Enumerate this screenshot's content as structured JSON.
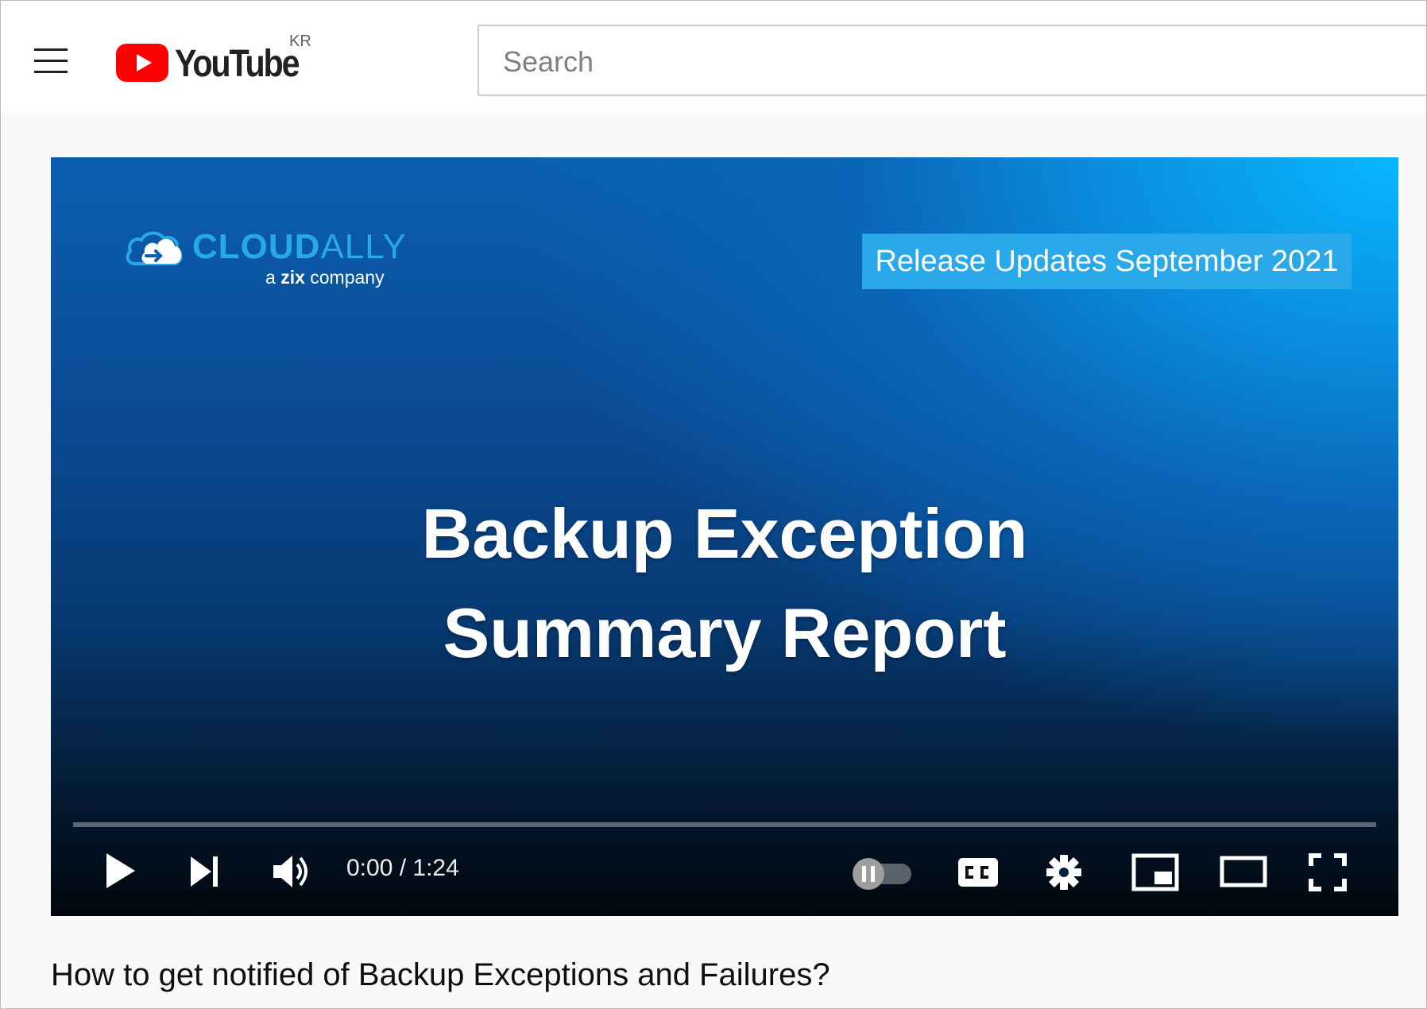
{
  "header": {
    "menu_icon": "hamburger-menu-icon",
    "logo_text": "YouTube",
    "country_code": "KR",
    "search_placeholder": "Search"
  },
  "video": {
    "brand_name_bold": "CLOUD",
    "brand_name_light": "ALLY",
    "brand_tagline_a": "a",
    "brand_tagline_zix": "zix",
    "brand_tagline_rest": "company",
    "release_badge": "Release Updates September 2021",
    "title_line1": "Backup Exception",
    "title_line2": "Summary Report",
    "progress_fraction": 0,
    "controls": {
      "current_time": "0:00",
      "duration": "1:24",
      "time_separator": " / ",
      "time_display": "0:00 / 1:24",
      "icons": [
        "play-icon",
        "next-icon",
        "volume-icon",
        "autoplay-toggle",
        "cc-icon",
        "settings-gear-icon",
        "miniplayer-icon",
        "theater-mode-icon",
        "fullscreen-icon"
      ]
    }
  },
  "page": {
    "video_title": "How to get notified of Backup Exceptions and Failures?"
  },
  "colors": {
    "youtube_red": "#ff0000",
    "brand_blue": "#27a9e8",
    "badge_blue": "#29a8ea"
  }
}
